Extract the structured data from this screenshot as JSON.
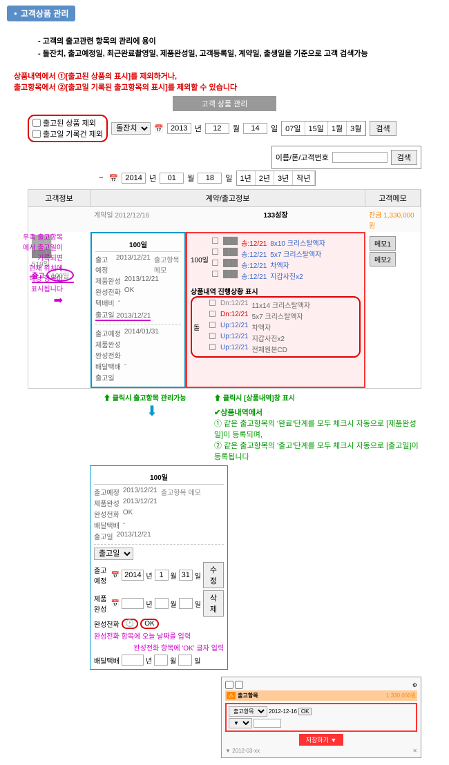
{
  "header": {
    "title": "고객상품 관리"
  },
  "notice": {
    "line1": "- 고객의 출고관련 항목의 관리에 용이",
    "line2": "- 돌잔치, 출고예정일, 최근완료촬영일, 제품완성일, 고객등록일, 계약일, 출생일을 기준으로 고객 검색가능"
  },
  "topNote": {
    "l1": "상품내역에서 ①[출고된 상품의 표시]를 제외하거나,",
    "l2": "출고항목에서 ②[출고일 기록된 출고항목의 표시]를 제외할 수 있습니다"
  },
  "subHeader": "고객 상품 관리",
  "filter": {
    "chk1": "출고된 상품 제외",
    "chk2": "출고일 기록건 제외",
    "select1": "돌잔치",
    "dateFrom": {
      "y": "2013",
      "m": "12",
      "d": "14"
    },
    "dateTo": {
      "y": "2014",
      "m": "01",
      "d": "18"
    },
    "quick": [
      "07일",
      "15일",
      "1월",
      "3월",
      "1년",
      "2년",
      "3년",
      "작년"
    ],
    "searchBtn": "검색",
    "searchLabel": "이름/폰/고객번호",
    "searchBtn2": "검색"
  },
  "table": {
    "headers": [
      "고객정보",
      "계약/출고정보",
      "고객메모"
    ],
    "contractDate": "계약일 2012/12/16",
    "studioName": "133성장",
    "deposit": "잔금 1,330,000원",
    "leftInfo": {
      "lines": [
        "",
        "",
        "",
        "519일"
      ],
      "hlLabel": "출고",
      "hlVal": "100일"
    },
    "midTitle": "100일",
    "midLines": [
      {
        "k": "출고예정",
        "v": "2013/12/21",
        "extra": "출고항목 메모"
      },
      {
        "k": "제품완성",
        "v": "2013/12/21"
      },
      {
        "k": "완성전화",
        "v": "OK"
      },
      {
        "k": "택배비",
        "v": "-"
      },
      {
        "k": "출고일",
        "v": "2013/12/21",
        "ul": true
      }
    ],
    "midLines2": [
      {
        "k": "출고예정",
        "v": "2014/01/31"
      },
      {
        "k": "제품완성",
        "v": ""
      },
      {
        "k": "완성전화",
        "v": ""
      },
      {
        "k": "배달택배",
        "v": "-"
      },
      {
        "k": "출고일",
        "v": ""
      }
    ],
    "rightDay": "100일",
    "rightItems": [
      {
        "pre": "송:12/21",
        "txt": "8x10 크리스탈액자",
        "c": "red"
      },
      {
        "pre": "송:12/21",
        "txt": "5x7 크리스탈액자",
        "c": "blue"
      },
      {
        "pre": "송:12/21",
        "txt": "차액자",
        "c": "blue"
      },
      {
        "pre": "송:12/21",
        "txt": "지갑사진x2",
        "c": "blue"
      }
    ],
    "rightSubTitle": "상품내역 진행상황 표시",
    "rightItems2": [
      {
        "pre": "Dn:12/21",
        "txt": "11x14 크리스탈액자"
      },
      {
        "pre": "Dn:12/21",
        "txt": "5x7 크리스탈액자"
      },
      {
        "pre": "Up:12/21",
        "txt": "차액자"
      },
      {
        "pre": "Up:12/21",
        "txt": "지갑사진x2"
      },
      {
        "pre": "Up:12/21",
        "txt": "전체원본CD"
      }
    ],
    "rightDay2": "돌",
    "memoBtns": [
      "메모1",
      "메모2"
    ]
  },
  "sideAnnotation": {
    "l1": "우측 출고항목에서 출고일이 기록되면",
    "l2": "현재 위치에 해당 항목이 표시됩니다"
  },
  "bottomAnno": {
    "left": "클릭시 출고항목 관리가능",
    "right": "클릭시 [상품내역]창 표시",
    "greenTitle": "✔상품내역에서",
    "green1": "① 같은 출고항목의 '완료'단계를 모두 체크시 자동으로 [제품완성일]이 등록되며,",
    "green2": "② 같은 출고항목의 '출고'단계를 모두 체크시 자동으로 [출고일]이 등록됩니다"
  },
  "miniCard": {
    "title": "100일",
    "lines": [
      {
        "k": "출고예정",
        "v": "2013/12/21",
        "extra": "출고항목 메모"
      },
      {
        "k": "제품완성",
        "v": "2013/12/21"
      },
      {
        "k": "완성전화",
        "v": "OK"
      },
      {
        "k": "배달택배",
        "v": "-"
      },
      {
        "k": "출고일",
        "v": "2013/12/21"
      }
    ],
    "editSel": "출고일",
    "editDate": {
      "y": "2014",
      "m": "1",
      "d": "31"
    },
    "btn1": "수정",
    "btn2": "삭제",
    "noteL": "완성전화 항목에 오늘 날짜를 입력",
    "noteR": "완성전화 항목에 'OK' 글자 입력"
  },
  "thumb": {
    "tabLabel": "출고항목",
    "row1": "2012-12-16",
    "amt": "1,330,000원"
  }
}
